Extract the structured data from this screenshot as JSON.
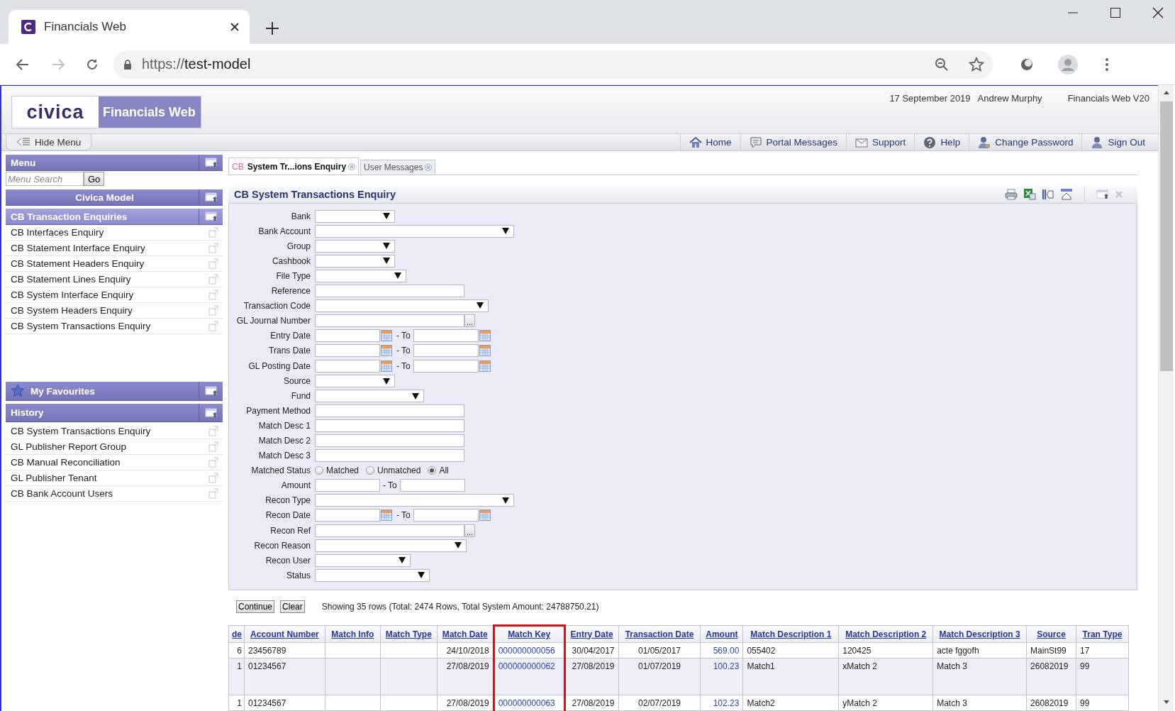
{
  "browser": {
    "tab_title": "Financials Web",
    "url_scheme": "https://",
    "url_host": "test-model"
  },
  "header": {
    "logo": "civica",
    "product": "Financials Web",
    "date": "17 September 2019",
    "user": "Andrew Murphy",
    "version": "Financials Web V20"
  },
  "nav": {
    "hide_menu": "Hide Menu",
    "links": [
      {
        "label": "Home",
        "kind": "home"
      },
      {
        "label": "Portal Messages",
        "kind": "messages"
      },
      {
        "label": "Support",
        "kind": "support"
      },
      {
        "label": "Help",
        "kind": "help"
      },
      {
        "label": "Change Password",
        "kind": "password"
      },
      {
        "label": "Sign Out",
        "kind": "signout"
      }
    ]
  },
  "sidebar": {
    "menu_title": "Menu",
    "search_placeholder": "Menu Search",
    "go": "Go",
    "model": "Civica Model",
    "group": "CB Transaction Enquiries",
    "items": [
      "CB Interfaces Enquiry",
      "CB Statement Interface Enquiry",
      "CB Statement Headers Enquiry",
      "CB Statement Lines Enquiry",
      "CB System Interface Enquiry",
      "CB System Headers Enquiry",
      "CB System Transactions Enquiry"
    ],
    "favourites_title": "My Favourites",
    "history_title": "History",
    "history": [
      "CB System Transactions Enquiry",
      "GL Publisher Report Group",
      "CB Manual Reconciliation",
      "GL Publisher Tenant",
      "CB Bank Account Users"
    ]
  },
  "tabs": [
    {
      "prefix": "CB",
      "label": "System Tr...ions Enquiry",
      "selected": true
    },
    {
      "label": "User Messages",
      "selected": false
    }
  ],
  "panel": {
    "title": "CB System Transactions Enquiry",
    "fields": [
      {
        "label": "Bank",
        "kind": "select"
      },
      {
        "label": "Bank Account",
        "kind": "select"
      },
      {
        "label": "Group",
        "kind": "select"
      },
      {
        "label": "Cashbook",
        "kind": "select"
      },
      {
        "label": "File Type",
        "kind": "select"
      },
      {
        "label": "Reference",
        "kind": "text"
      },
      {
        "label": "Transaction Code",
        "kind": "select"
      },
      {
        "label": "GL Journal Number",
        "kind": "lookup",
        "button": "..."
      },
      {
        "label": "Entry Date",
        "kind": "date_range",
        "separator": "- To"
      },
      {
        "label": "Trans Date",
        "kind": "date_range",
        "separator": "- To"
      },
      {
        "label": "GL Posting Date",
        "kind": "date_range",
        "separator": "- To"
      },
      {
        "label": "Source",
        "kind": "select"
      },
      {
        "label": "Fund",
        "kind": "select"
      },
      {
        "label": "Payment Method",
        "kind": "text"
      },
      {
        "label": "Match Desc 1",
        "kind": "text"
      },
      {
        "label": "Match Desc 2",
        "kind": "text"
      },
      {
        "label": "Match Desc 3",
        "kind": "text"
      },
      {
        "label": "Matched Status",
        "kind": "radio",
        "options": [
          {
            "label": "Matched",
            "selected": false
          },
          {
            "label": "Unmatched",
            "selected": false
          },
          {
            "label": "All",
            "selected": true
          }
        ]
      },
      {
        "label": "Amount",
        "kind": "range",
        "separator": "- To"
      },
      {
        "label": "Recon Type",
        "kind": "select"
      },
      {
        "label": "Recon Date",
        "kind": "date_range",
        "separator": "- To"
      },
      {
        "label": "Recon Ref",
        "kind": "lookup",
        "button": "..."
      },
      {
        "label": "Recon Reason",
        "kind": "select"
      },
      {
        "label": "Recon User",
        "kind": "select"
      },
      {
        "label": "Status",
        "kind": "select"
      }
    ]
  },
  "actions": {
    "buttons": [
      "Continue",
      "Clear"
    ],
    "summary": "Showing 35 rows (Total: 2474 Rows, Total System Amount: 24788750.21)"
  },
  "table": {
    "columns": [
      {
        "label": "de",
        "highlighted": false
      },
      {
        "label": "Account Number",
        "highlighted": false
      },
      {
        "label": "Match Info",
        "highlighted": false
      },
      {
        "label": "Match Type",
        "highlighted": false
      },
      {
        "label": "Match Date",
        "highlighted": false
      },
      {
        "label": "Match Key",
        "highlighted": true
      },
      {
        "label": "Entry Date",
        "highlighted": false
      },
      {
        "label": "Transaction Date",
        "highlighted": false
      },
      {
        "label": "Amount",
        "highlighted": false
      },
      {
        "label": "Match Description 1",
        "highlighted": false
      },
      {
        "label": "Match Description 2",
        "highlighted": false
      },
      {
        "label": "Match Description 3",
        "highlighted": false
      },
      {
        "label": "Source",
        "highlighted": false
      },
      {
        "label": "Tran Type",
        "highlighted": false
      }
    ],
    "rows": [
      [
        "6",
        "23456789",
        "",
        "",
        "24/10/2018",
        "000000000056",
        "30/04/2017",
        "01/05/2017",
        "569.00",
        "055402",
        "120425",
        "acte fggofh",
        "MainSt99",
        "17"
      ],
      [
        "1",
        "01234567",
        "",
        "",
        "27/08/2019",
        "000000000062",
        "27/08/2019",
        "01/07/2019",
        "100.23",
        "Match1",
        "xMatch 2",
        "Match 3",
        "26082019",
        "99"
      ],
      [
        "1",
        "01234567",
        "",
        "",
        "27/08/2019",
        "000000000063",
        "27/08/2019",
        "02/07/2019",
        "102.23",
        "Match2",
        "yMatch 2",
        "Match 3",
        "26082019",
        "99"
      ]
    ]
  }
}
